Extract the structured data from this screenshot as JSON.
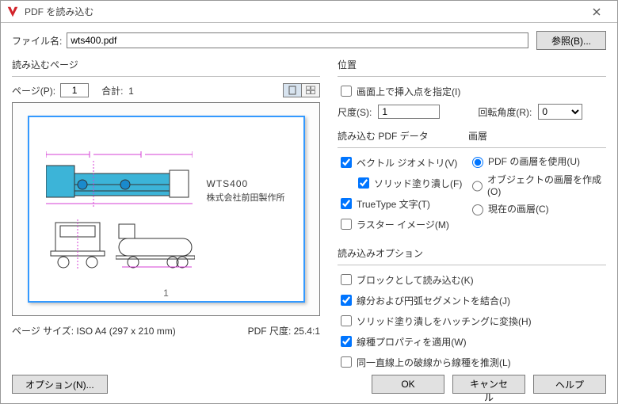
{
  "window": {
    "title": "PDF を読み込む"
  },
  "file": {
    "label": "ファイル名:",
    "value": "wts400.pdf",
    "browse": "参照(B)..."
  },
  "pageSection": {
    "title": "読み込むページ",
    "pageLabel": "ページ(P):",
    "pageValue": "1",
    "totalLabel": "合計:",
    "totalValue": "1",
    "pageNum": "1",
    "sizeLabel": "ページ サイズ: ISO A4 (297 x 210 mm)",
    "scaleLabel": "PDF 尺度:",
    "scaleValue": "25.4:1",
    "drawingTitle": "WTS400",
    "drawingSub": "株式会社前田製作所"
  },
  "placement": {
    "title": "位置",
    "specifyOnScreen": {
      "label": "画面上で挿入点を指定(I)",
      "checked": false
    },
    "scaleLabel": "尺度(S):",
    "scaleValue": "1",
    "rotationLabel": "回転角度(R):",
    "rotationValue": "0"
  },
  "pdfData": {
    "title": "読み込む PDF データ",
    "vectorGeom": {
      "label": "ベクトル ジオメトリ(V)",
      "checked": true
    },
    "solidFill": {
      "label": "ソリッド塗り潰し(F)",
      "checked": true
    },
    "trueType": {
      "label": "TrueType 文字(T)",
      "checked": true
    },
    "raster": {
      "label": "ラスター イメージ(M)",
      "checked": false
    }
  },
  "layer": {
    "title": "画層",
    "usePdf": {
      "label": "PDF の画層を使用(U)",
      "selected": true
    },
    "createObj": {
      "label": "オブジェクトの画層を作成(O)",
      "selected": false
    },
    "current": {
      "label": "現在の画層(C)",
      "selected": false
    }
  },
  "importOpts": {
    "title": "読み込みオプション",
    "asBlock": {
      "label": "ブロックとして読み込む(K)",
      "checked": false
    },
    "joinArcs": {
      "label": "線分および円弧セグメントを結合(J)",
      "checked": true
    },
    "solidToHatch": {
      "label": "ソリッド塗り潰しをハッチングに変換(H)",
      "checked": false
    },
    "applyLtype": {
      "label": "線種プロパティを適用(W)",
      "checked": true
    },
    "inferDashed": {
      "label": "同一直線上の破線から線種を推測(L)",
      "checked": false
    }
  },
  "buttons": {
    "options": "オプション(N)...",
    "ok": "OK",
    "cancel": "キャンセル",
    "help": "ヘルプ"
  }
}
